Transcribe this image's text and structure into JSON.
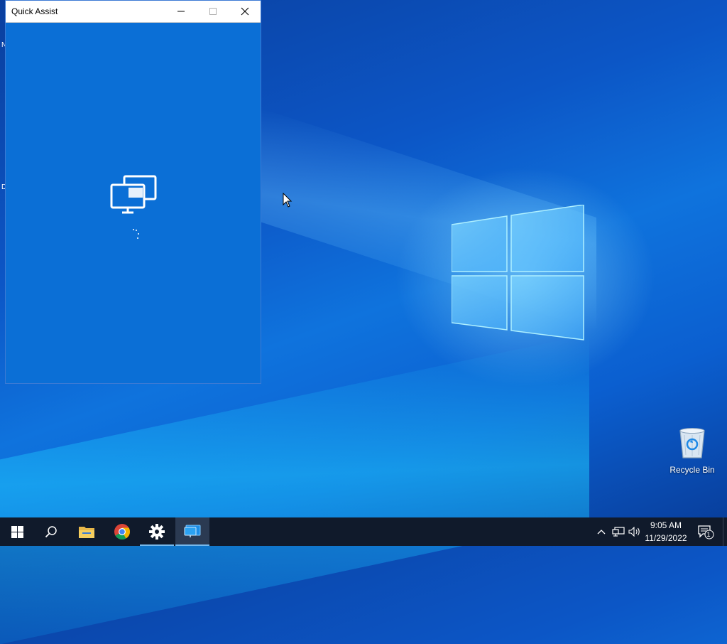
{
  "window": {
    "title": "Quick Assist",
    "minimize_icon": "minimize-icon",
    "maximize_icon": "maximize-icon",
    "close_icon": "close-icon",
    "body_icon": "remote-screens-icon"
  },
  "desktop": {
    "edge_chars": [
      "N",
      "D"
    ],
    "recycle_bin_label": "Recycle Bin"
  },
  "taskbar": {
    "items": [
      {
        "name": "start-button",
        "icon": "windows-start-icon"
      },
      {
        "name": "search-button",
        "icon": "search-icon"
      },
      {
        "name": "file-explorer-button",
        "icon": "folder-icon"
      },
      {
        "name": "chrome-button",
        "icon": "chrome-icon"
      },
      {
        "name": "settings-button",
        "icon": "gear-icon"
      },
      {
        "name": "quick-assist-button",
        "icon": "quick-assist-icon",
        "active": true
      }
    ],
    "tray": {
      "chevron": "chevron-up-icon",
      "network": "network-icon",
      "volume": "volume-icon",
      "time": "9:05 AM",
      "date": "11/29/2022",
      "notification_count": "1"
    }
  },
  "colors": {
    "accent": "#0b6fd6",
    "taskbar": "#101a2b",
    "active_underline": "#76b9ed"
  }
}
